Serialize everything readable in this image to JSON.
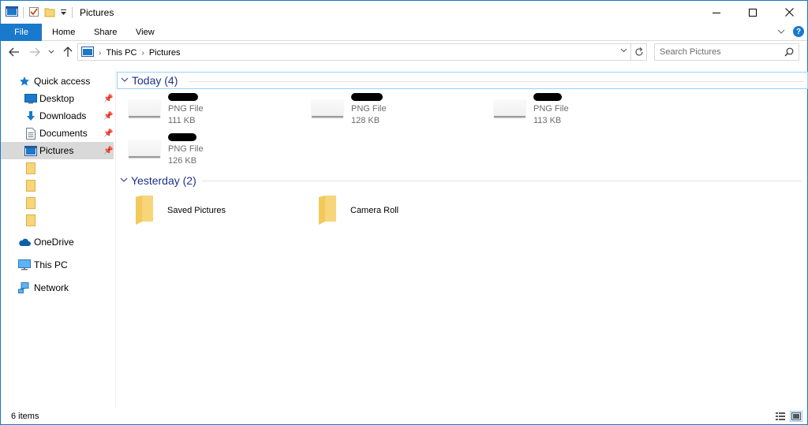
{
  "window": {
    "title": "Pictures",
    "controls": {
      "minimize": "—",
      "maximize": "☐",
      "close": "✕"
    }
  },
  "ribbon": {
    "tabs": [
      "File",
      "Home",
      "Share",
      "View"
    ],
    "expand_glyph": "∨",
    "help_glyph": "?"
  },
  "address": {
    "crumbs": [
      "This PC",
      "Pictures"
    ],
    "search_placeholder": "Search Pictures"
  },
  "nav": {
    "items": [
      {
        "label": "Quick access",
        "icon": "star-icon",
        "pinned": false,
        "selected": false
      },
      {
        "label": "Desktop",
        "icon": "desktop-icon",
        "pinned": true,
        "selected": false
      },
      {
        "label": "Downloads",
        "icon": "download-icon",
        "pinned": true,
        "selected": false
      },
      {
        "label": "Documents",
        "icon": "documents-icon",
        "pinned": true,
        "selected": false
      },
      {
        "label": "Pictures",
        "icon": "pictures-icon",
        "pinned": true,
        "selected": true
      },
      {
        "label": "",
        "icon": "folder-icon",
        "pinned": false,
        "selected": false
      },
      {
        "label": "",
        "icon": "folder-icon",
        "pinned": false,
        "selected": false
      },
      {
        "label": "",
        "icon": "folder-icon",
        "pinned": false,
        "selected": false
      },
      {
        "label": "",
        "icon": "folder-icon",
        "pinned": false,
        "selected": false
      },
      {
        "label": "OneDrive",
        "icon": "cloud-icon",
        "pinned": false,
        "selected": false
      },
      {
        "label": "This PC",
        "icon": "computer-icon",
        "pinned": false,
        "selected": false
      },
      {
        "label": "Network",
        "icon": "network-icon",
        "pinned": false,
        "selected": false
      }
    ]
  },
  "groups": {
    "today": {
      "label": "Today (4)",
      "files": [
        {
          "type": "PNG File",
          "size": "111 KB"
        },
        {
          "type": "PNG File",
          "size": "128 KB"
        },
        {
          "type": "PNG File",
          "size": "113 KB"
        },
        {
          "type": "PNG File",
          "size": "126 KB"
        }
      ]
    },
    "yesterday": {
      "label": "Yesterday (2)",
      "folders": [
        {
          "name": "Saved Pictures"
        },
        {
          "name": "Camera Roll"
        }
      ]
    }
  },
  "status": {
    "item_count": "6 items"
  },
  "colors": {
    "accent": "#1979ca",
    "group_header": "#1e3287",
    "selection": "#d9d9d9",
    "folder": "#f7d57a"
  }
}
